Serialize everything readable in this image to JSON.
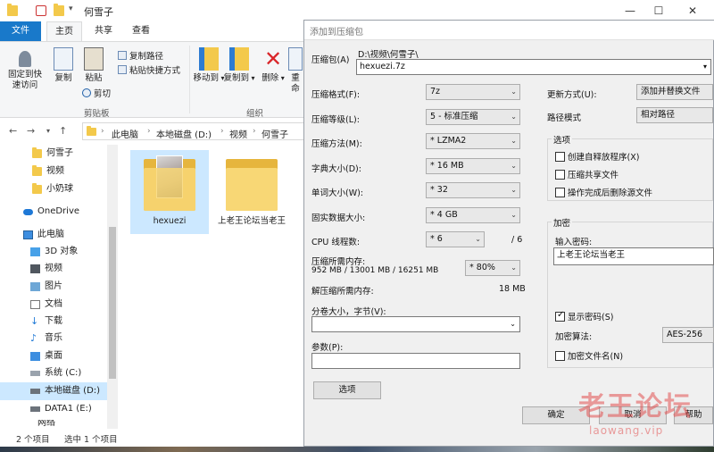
{
  "explorer": {
    "title": "何雪子",
    "tabs": [
      {
        "label": "文件"
      },
      {
        "label": "主页"
      },
      {
        "label": "共享"
      },
      {
        "label": "查看"
      }
    ],
    "ribbon": {
      "pin_label": "固定到快速访问",
      "copy_label": "复制",
      "paste_label": "粘贴",
      "copy_path": "复制路径",
      "paste_shortcut": "粘贴快捷方式",
      "cut": "剪切",
      "clipboard_group": "剪贴板",
      "move_to": "移动到",
      "copy_to": "复制到",
      "delete": "删除",
      "rename": "重命",
      "organize_group": "组织"
    },
    "breadcrumb": [
      "此电脑",
      "本地磁盘 (D:)",
      "视频",
      "何雪子"
    ],
    "nav_items": [
      {
        "label": "何雪子"
      },
      {
        "label": "视频"
      },
      {
        "label": "小奶球"
      },
      {
        "label": "OneDrive"
      },
      {
        "label": "此电脑"
      },
      {
        "label": "3D 对象"
      },
      {
        "label": "视频"
      },
      {
        "label": "图片"
      },
      {
        "label": "文档"
      },
      {
        "label": "下载"
      },
      {
        "label": "音乐"
      },
      {
        "label": "桌面"
      },
      {
        "label": "系统 (C:)"
      },
      {
        "label": "本地磁盘 (D:)"
      },
      {
        "label": "DATA1 (E:)"
      },
      {
        "label": "网络"
      }
    ],
    "files": [
      {
        "name": "hexuezi"
      },
      {
        "name": "上老王论坛当老王"
      }
    ],
    "status": {
      "count": "2 个项目",
      "selected": "选中 1 个项目"
    }
  },
  "dialog": {
    "title": "添加到压缩包",
    "archive_label": "压缩包(A)",
    "archive_dir": "D:\\视频\\何雪子\\",
    "archive_name": "hexuezi.7z",
    "format_label": "压缩格式(F):",
    "format_value": "7z",
    "level_label": "压缩等级(L):",
    "level_value": "5 - 标准压缩",
    "method_label": "压缩方法(M):",
    "method_value": "* LZMA2",
    "dict_label": "字典大小(D):",
    "dict_value": "* 16 MB",
    "word_label": "单词大小(W):",
    "word_value": "* 32",
    "solid_label": "固实数据大小:",
    "solid_value": "* 4 GB",
    "threads_label": "CPU 线程数:",
    "threads_value": "* 6",
    "threads_total": "/ 6",
    "mem_comp_label": "压缩所需内存:",
    "mem_comp_value": "952 MB / 13001 MB / 16251 MB",
    "mem_percent": "* 80%",
    "mem_decomp_label": "解压缩所需内存:",
    "mem_decomp_value": "18 MB",
    "split_label": "分卷大小，字节(V):",
    "split_value": "",
    "params_label": "参数(P):",
    "params_value": "",
    "options_button": "选项",
    "update_label": "更新方式(U):",
    "update_value": "添加并替换文件",
    "path_label": "路径模式",
    "path_value": "相对路径",
    "options_group": "选项",
    "opt_sfx": "创建自释放程序(X)",
    "opt_shared": "压缩共享文件",
    "opt_delete": "操作完成后删除源文件",
    "encrypt_group": "加密",
    "password_label": "输入密码:",
    "password_value": "上老王论坛当老王",
    "show_password": "显示密码(S)",
    "enc_method_label": "加密算法:",
    "enc_method_value": "AES-256",
    "enc_names": "加密文件名(N)",
    "ok": "确定",
    "cancel": "取消",
    "help": "帮助"
  },
  "watermark": {
    "text": "老王论坛",
    "url": "laowang.vip"
  },
  "colors": {
    "file_tab": "#1979ca",
    "selection": "#cce8ff"
  }
}
